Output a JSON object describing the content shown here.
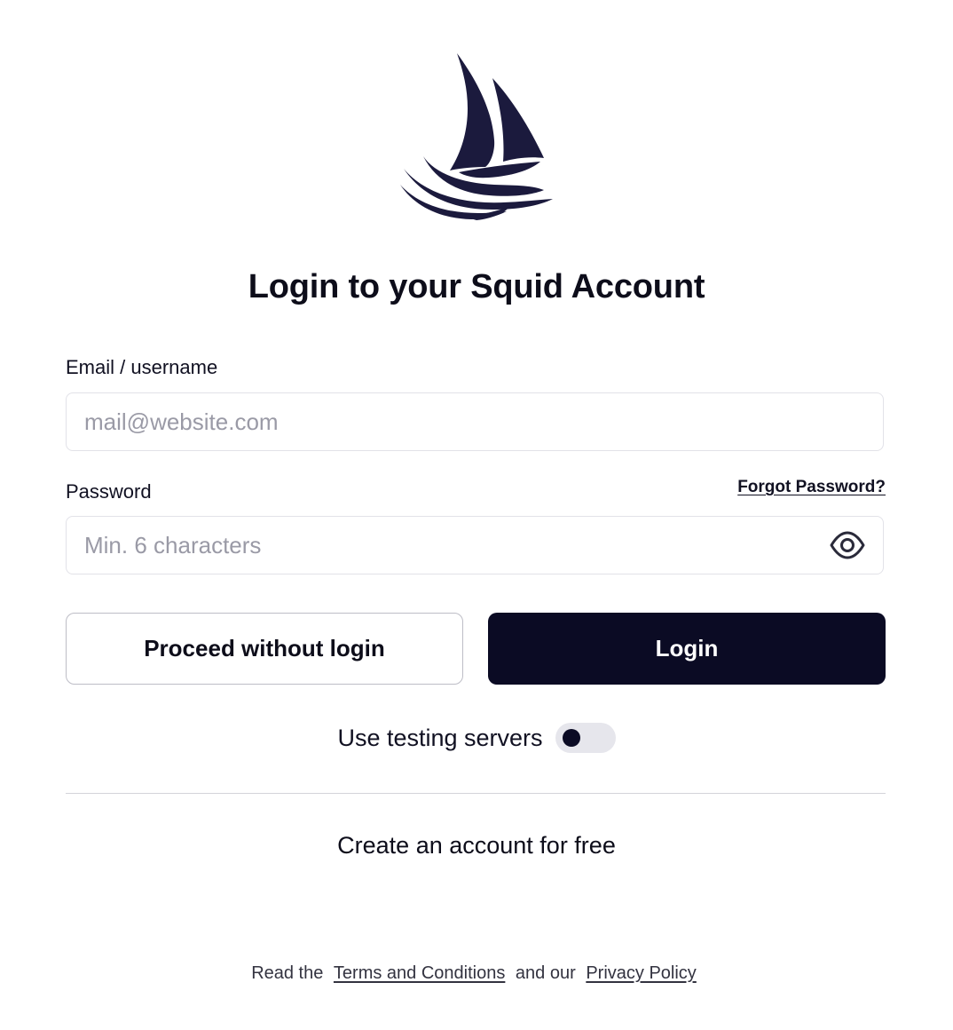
{
  "logo": {
    "icon": "sailboat-icon",
    "color": "#1b1a3d"
  },
  "title": "Login to your Squid Account",
  "email": {
    "label": "Email / username",
    "placeholder": "mail@website.com",
    "value": ""
  },
  "password": {
    "label": "Password",
    "placeholder": "Min. 6 characters",
    "value": "",
    "forgot_label": "Forgot Password?",
    "visibility_icon": "eye-icon"
  },
  "buttons": {
    "proceed_label": "Proceed without login",
    "login_label": "Login"
  },
  "testing_servers": {
    "label": "Use testing servers",
    "enabled": false
  },
  "create_account_label": "Create an account for free",
  "legal": {
    "prefix": "Read the",
    "terms_label": "Terms and Conditions",
    "middle": "and our",
    "privacy_label": "Privacy Policy"
  },
  "colors": {
    "primary": "#0b0b24",
    "border": "#e2e2e8",
    "placeholder": "#9a9aa6"
  }
}
